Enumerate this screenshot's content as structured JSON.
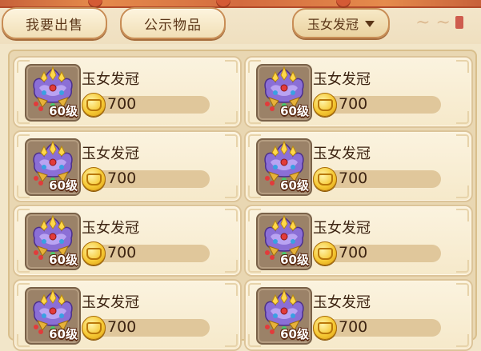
{
  "tabs": [
    {
      "label": "我要出售"
    },
    {
      "label": "公示物品"
    }
  ],
  "filter": {
    "selected": "玉女发冠"
  },
  "items": [
    {
      "name": "玉女发冠",
      "level": "60级",
      "price": "700"
    },
    {
      "name": "玉女发冠",
      "level": "60级",
      "price": "700"
    },
    {
      "name": "玉女发冠",
      "level": "60级",
      "price": "700"
    },
    {
      "name": "玉女发冠",
      "level": "60级",
      "price": "700"
    },
    {
      "name": "玉女发冠",
      "level": "60级",
      "price": "700"
    },
    {
      "name": "玉女发冠",
      "level": "60级",
      "price": "700"
    },
    {
      "name": "玉女发冠",
      "level": "60级",
      "price": "700"
    },
    {
      "name": "玉女发冠",
      "level": "60级",
      "price": "700"
    }
  ],
  "colors": {
    "accent": "#c88d55",
    "card_bg": "#fbf3df",
    "text": "#3d2412"
  },
  "icons": {
    "item": "crown-icon",
    "currency": "gold-coin-icon",
    "dropdown": "caret-down-icon"
  }
}
